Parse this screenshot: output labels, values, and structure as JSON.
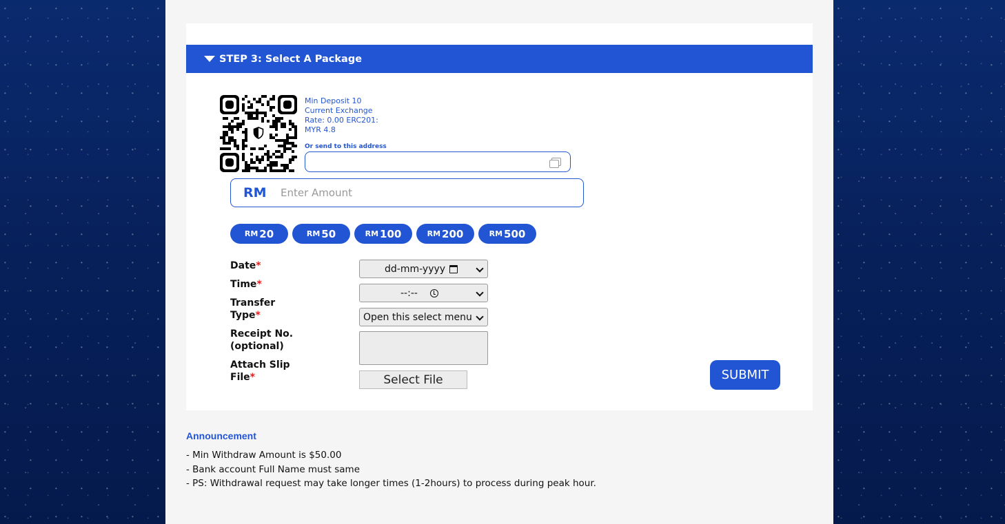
{
  "step": {
    "title": "STEP 3: Select A Package"
  },
  "deposit_info": {
    "line1": "Min Deposit 10",
    "line2": "Current Exchange",
    "line3": "Rate: 0.00 ERC201:",
    "line4": "MYR 4.8"
  },
  "address": {
    "label": "Or send to this address",
    "value": ""
  },
  "amount": {
    "currency": "RM",
    "placeholder": "Enter Amount"
  },
  "quick_amounts": [
    {
      "currency": "RM",
      "value": "20"
    },
    {
      "currency": "RM",
      "value": "50"
    },
    {
      "currency": "RM",
      "value": "100"
    },
    {
      "currency": "RM",
      "value": "200"
    },
    {
      "currency": "RM",
      "value": "500"
    }
  ],
  "form": {
    "date_label": "Date",
    "time_label": "Time",
    "transfer_label_1": "Transfer",
    "transfer_label_2": "Type",
    "receipt_label_1": "Receipt No.",
    "receipt_label_2": "(optional)",
    "slip_label_1": "Attach Slip",
    "slip_label_2": "File",
    "required_mark": "*",
    "date_value": "dd-mm-yyyy",
    "time_value": "--:--",
    "transfer_value": "Open this select menu",
    "file_button": "Select File",
    "submit": "SUBMIT"
  },
  "announcement": {
    "title": "Announcement",
    "items": [
      "- Min Withdraw Amount is $50.00",
      "- Bank account Full Name must same",
      "- PS: Withdrawal request may take longer times (1-2hours) to process during peak hour."
    ]
  },
  "colors": {
    "accent": "#2255d4",
    "required": "#e31b1b",
    "background": "#08215c"
  }
}
